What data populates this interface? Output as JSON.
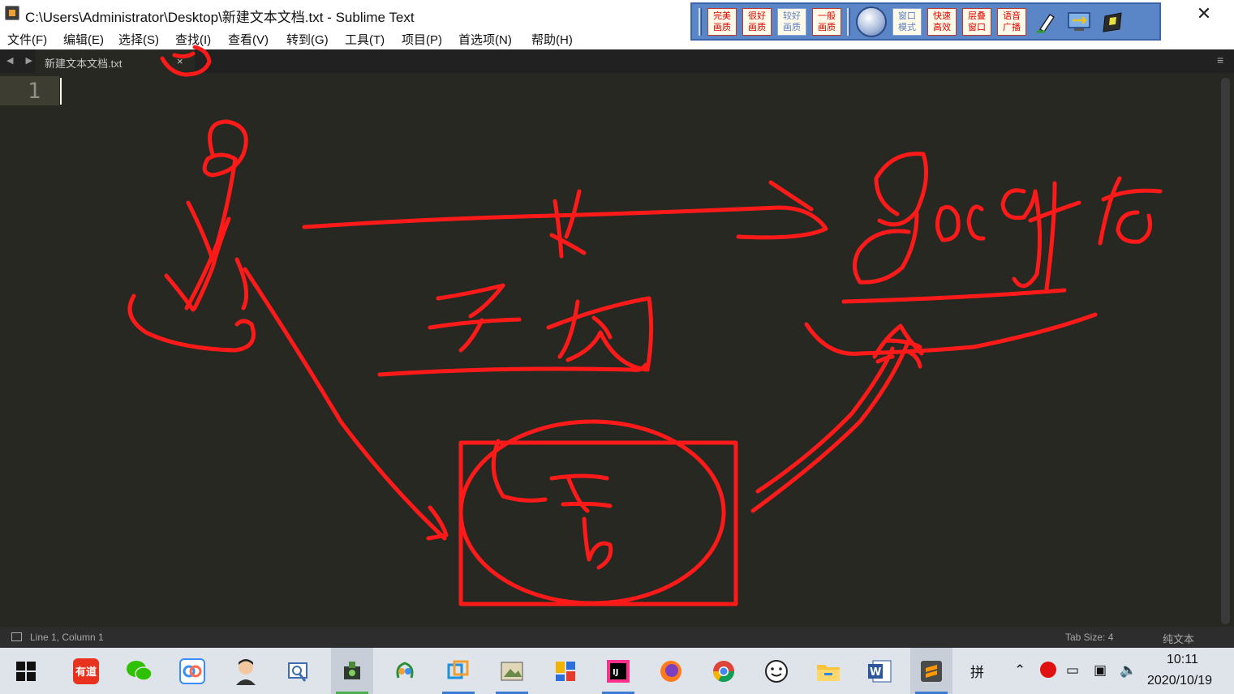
{
  "window": {
    "title": "C:\\Users\\Administrator\\Desktop\\新建文本文档.txt - Sublime Text",
    "close_glyph": "✕"
  },
  "menu": [
    {
      "label": "文件(F)"
    },
    {
      "label": "编辑(E)"
    },
    {
      "label": "选择(S)"
    },
    {
      "label": "查找(I)"
    },
    {
      "label": "查看(V)"
    },
    {
      "label": "转到(G)"
    },
    {
      "label": "工具(T)"
    },
    {
      "label": "项目(P)"
    },
    {
      "label": "首选项(N)"
    },
    {
      "label": "帮助(H)"
    }
  ],
  "quality_toolbar": {
    "buttons": [
      {
        "line1": "完美",
        "line2": "画质"
      },
      {
        "line1": "很好",
        "line2": "画质"
      },
      {
        "line1": "较好",
        "line2": "画质"
      },
      {
        "line1": "一般",
        "line2": "画质"
      },
      {
        "line1": "窗口",
        "line2": "模式"
      },
      {
        "line1": "快速",
        "line2": "高效"
      },
      {
        "line1": "层叠",
        "line2": "窗口"
      },
      {
        "line1": "语音",
        "line2": "广播"
      }
    ],
    "icons": [
      "camera-lens-icon",
      "marker-pen-icon",
      "network-monitor-icon",
      "screen-capture-icon"
    ]
  },
  "tabs": {
    "nav": "◀ ▶",
    "file_name": "新建文本文档.txt",
    "close_glyph": "×",
    "menu_glyph": "≡"
  },
  "editor": {
    "line_numbers": [
      "1"
    ],
    "content": ""
  },
  "status": {
    "position": "Line 1, Column 1",
    "tab_size": "Tab Size: 4",
    "syntax": "纯文本"
  },
  "taskbar": {
    "apps": [
      "youdao-dict-icon",
      "wechat-icon",
      "baidu-netdisk-icon",
      "avatar-app-icon",
      "search-doc-icon",
      "camera-app-icon",
      "navicat-icon",
      "vmware-icon",
      "photo-viewer-icon",
      "app-tiles-icon",
      "intellij-icon",
      "firefox-icon",
      "chrome-icon",
      "smiley-app-icon",
      "file-explorer-icon",
      "word-icon",
      "sublime-text-icon"
    ],
    "youdao_label": "有道",
    "ime": "拼",
    "time": "10:11",
    "date": "2020/10/19"
  },
  "colors": {
    "editor_bg": "#272822",
    "annotation": "#ff1a1a",
    "toolbar_bg": "#5a86c8"
  }
}
